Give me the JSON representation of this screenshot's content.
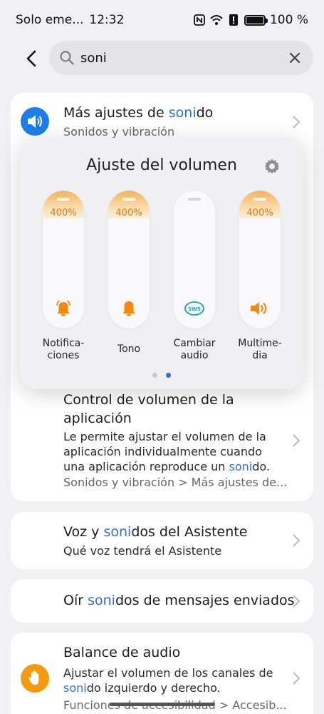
{
  "status_bar": {
    "carrier": "Solo eme...",
    "time": "12:32",
    "battery": "100 %"
  },
  "search": {
    "query": "soni",
    "placeholder": ""
  },
  "results": [
    {
      "title_pre": "Más ajustes de ",
      "title_hl": "soni",
      "title_post": "do",
      "subtitle": "Sonidos y vibración"
    },
    {
      "title": "Control de volumen de la aplicación",
      "desc_pre": "Le permite ajustar el volumen de la aplicación individualmente cuando una aplicación reproduce un ",
      "desc_hl": "soni",
      "desc_post": "do.",
      "path": "Sonidos y vibración > Más ajustes de..."
    },
    {
      "title_pre": "Voz y ",
      "title_hl": "soni",
      "title_post": "dos del Asistente",
      "subtitle": "Qué voz tendrá el Asistente"
    },
    {
      "title_pre": "Oír ",
      "title_hl": "soni",
      "title_post": "dos de mensajes enviados"
    },
    {
      "title": "Balance de audio",
      "desc_pre": "Ajustar el volumen de los canales de ",
      "desc_hl": "soni",
      "desc_post": "do izquierdo y derecho.",
      "path": "Funciones de accesibilidad > Accesib..."
    }
  ],
  "volume_panel": {
    "title": "Ajuste del volumen",
    "sliders": [
      {
        "label": "Notifica-\nciones",
        "percent": "400%",
        "level": 0.2,
        "icon": "alarm-bell-icon"
      },
      {
        "label": "Tono",
        "percent": "400%",
        "level": 0.2,
        "icon": "bell-icon"
      },
      {
        "label": "Cambiar\naudio",
        "percent": "",
        "level": 0,
        "icon": "sws-icon",
        "icon_text": "SWS"
      },
      {
        "label": "Multime-\ndia",
        "percent": "400%",
        "level": 0.2,
        "icon": "speaker-icon"
      }
    ],
    "page_count": 2,
    "active_page": 2
  },
  "colors": {
    "accent": "#2f6fd6",
    "orange": "#f08a12",
    "background": "#f1f1f3"
  }
}
